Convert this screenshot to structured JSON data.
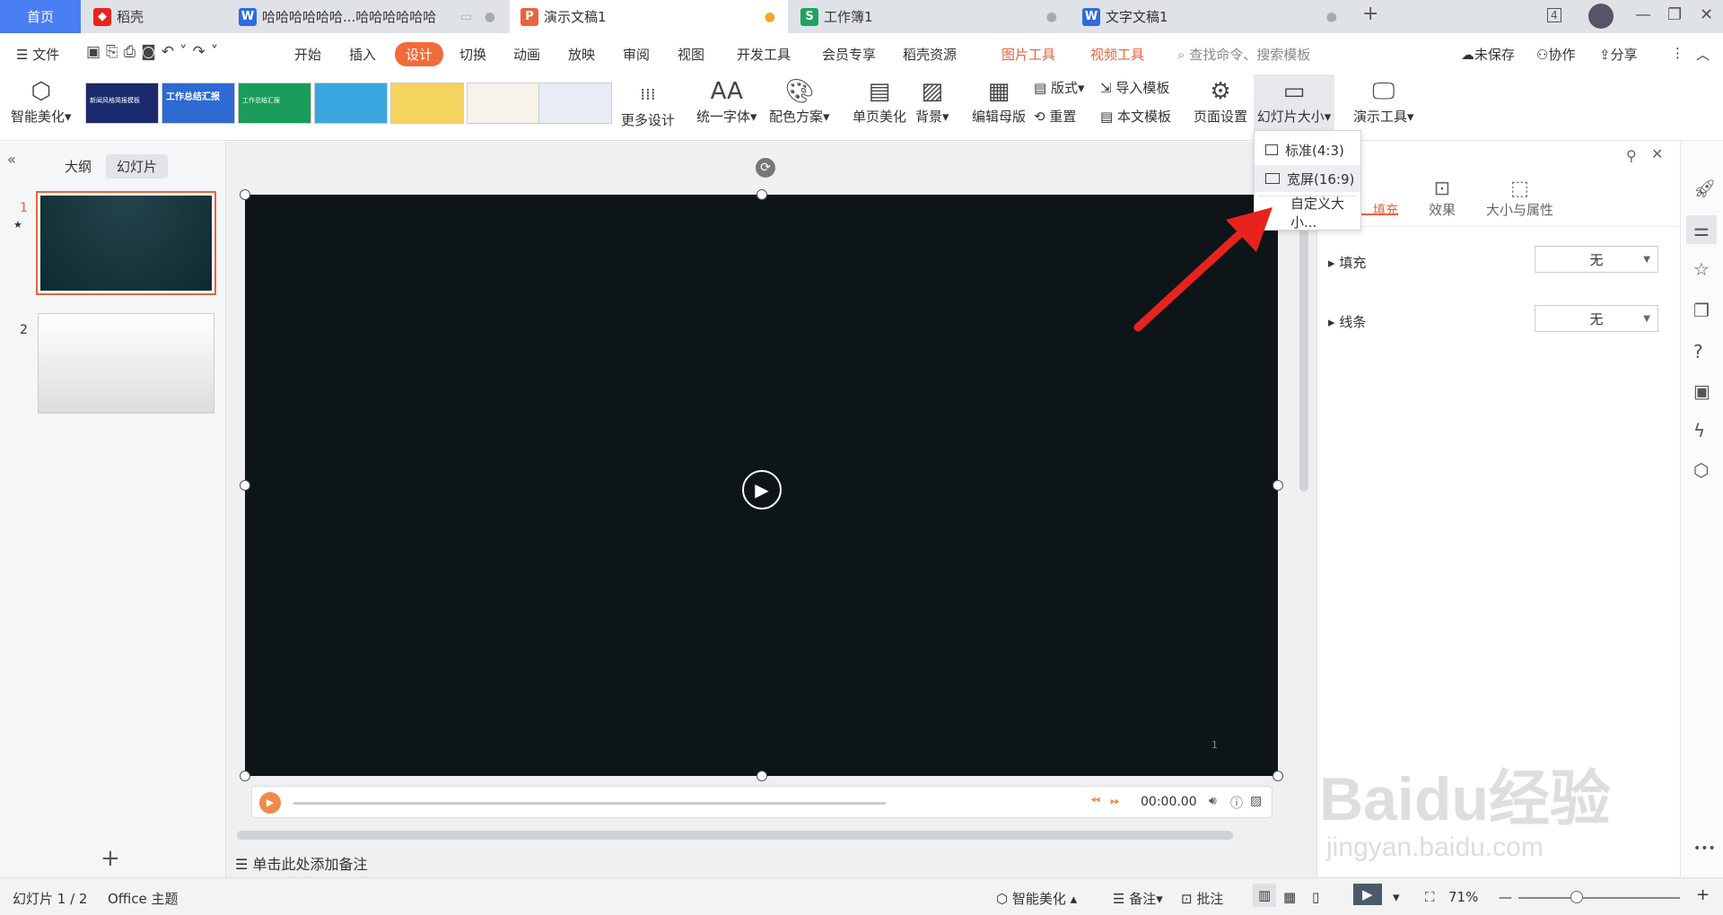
{
  "tabs": {
    "home": "首页",
    "daoke": "稻壳",
    "doc_long": "哈哈哈哈哈哈...哈哈哈哈哈哈",
    "ppt": "演示文稿1",
    "sheet": "工作簿1",
    "doc": "文字文稿1",
    "badge": "4"
  },
  "menu": {
    "file": "文件",
    "items": [
      "开始",
      "插入",
      "设计",
      "切换",
      "动画",
      "放映",
      "审阅",
      "视图",
      "开发工具",
      "会员专享",
      "稻壳资源"
    ],
    "pic_tool": "图片工具",
    "video_tool": "视频工具",
    "search": "查找命令、搜索模板",
    "unsaved": "未保存",
    "collab": "协作",
    "share": "分享"
  },
  "ribbon": {
    "smart": "智能美化",
    "more": "更多设计",
    "font": "统一字体",
    "color": "配色方案",
    "single": "单页美化",
    "bg": "背景",
    "master": "编辑母版",
    "layout": "版式",
    "reset": "重置",
    "import": "导入模板",
    "thisdoc": "本文模板",
    "pagesetup": "页面设置",
    "slidesize": "幻灯片大小",
    "presenttool": "演示工具"
  },
  "templates": [
    {
      "text": "新闻风格简报模板",
      "color": "#1a2a6c"
    },
    {
      "text": "工作总结汇报",
      "color": "#2d6ad1"
    },
    {
      "text": "工作总结汇报",
      "color": "#1a9c5b"
    },
    {
      "text": "",
      "color": "#3aa7e0"
    },
    {
      "text": "",
      "color": "#f4d35e"
    },
    {
      "text": "",
      "color": "#f7f2ea"
    },
    {
      "text": "",
      "color": "#e8ecf5"
    }
  ],
  "dropdown": {
    "standard": "标准(4:3)",
    "wide": "宽屏(16:9)",
    "custom": "自定义大小..."
  },
  "left": {
    "outline": "大纲",
    "slides": "幻灯片",
    "n1": "1",
    "n2": "2",
    "add": "+"
  },
  "slide": {
    "pagenum": "1",
    "time": "00:00.00"
  },
  "notes": "单击此处添加备注",
  "right": {
    "tab1": "填充",
    "tab2": "效果",
    "tab3": "大小与属性",
    "fill": "填充",
    "fill_val": "无",
    "line": "线条",
    "line_val": "无"
  },
  "status": {
    "slide": "幻灯片 1 / 2",
    "theme": "Office 主题",
    "smart": "智能美化",
    "notes": "备注",
    "comment": "批注",
    "zoom": "71%"
  },
  "watermark": {
    "brand": "Baidu经验",
    "url": "jingyan.baidu.com"
  },
  "colors": {
    "accent": "#f26b3a",
    "blue": "#4a7ef3",
    "red": "#e8231e"
  }
}
